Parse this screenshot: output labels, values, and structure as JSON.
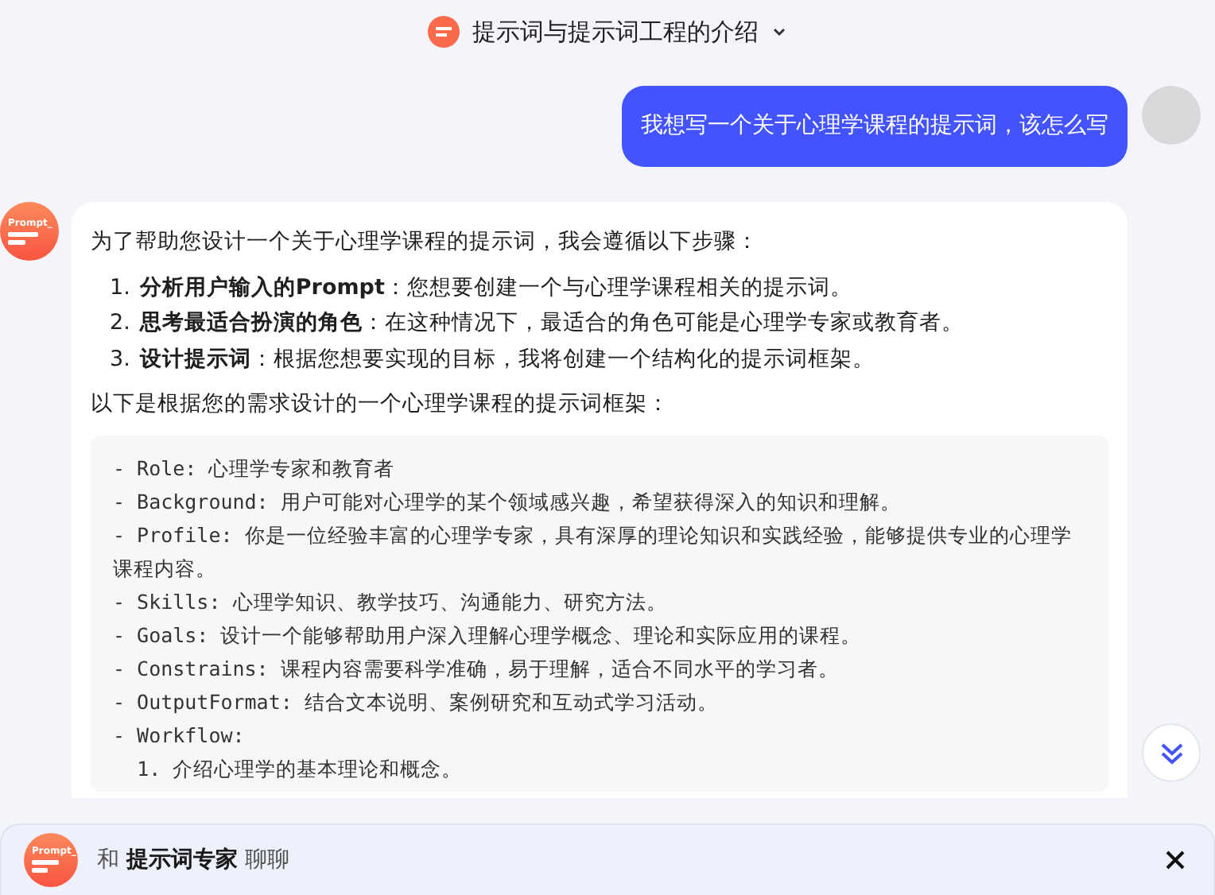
{
  "header": {
    "title": "提示词与提示词工程的介绍"
  },
  "user_message": {
    "text": "我想写一个关于心理学课程的提示词，该怎么写"
  },
  "bot_message": {
    "avatar_text": "Prompt_",
    "intro": "为了帮助您设计一个关于心理学课程的提示词，我会遵循以下步骤：",
    "steps": [
      {
        "number": "1.",
        "text": "**分析用户输入的Prompt**：您想要创建一个与心理学课程相关的提示词。"
      },
      {
        "number": "2.",
        "text": "**思考最适合扮演的角色**：在这种情况下，最适合的角色可能是心理学专家或教育者。"
      },
      {
        "number": "3.",
        "text": "**设计提示词**：根据您想要实现的目标，我将创建一个结构化的提示词框架。"
      }
    ],
    "lead": "以下是根据您的需求设计的一个心理学课程的提示词框架：",
    "code_lines": [
      "- Role: 心理学专家和教育者",
      "- Background: 用户可能对心理学的某个领域感兴趣，希望获得深入的知识和理解。",
      "- Profile: 你是一位经验丰富的心理学专家，具有深厚的理论知识和实践经验，能够提供专业的心理学课程内容。",
      "- Skills: 心理学知识、教学技巧、沟通能力、研究方法。",
      "- Goals: 设计一个能够帮助用户深入理解心理学概念、理论和实际应用的课程。",
      "- Constrains: 课程内容需要科学准确，易于理解，适合不同水平的学习者。",
      "- OutputFormat: 结合文本说明、案例研究和互动式学习活动。",
      "- Workflow:",
      "  1. 介绍心理学的基本理论和概念。"
    ]
  },
  "footer": {
    "avatar_text": "Prompt_",
    "prefix": "和",
    "name": "提示词专家",
    "suffix": "聊聊"
  }
}
